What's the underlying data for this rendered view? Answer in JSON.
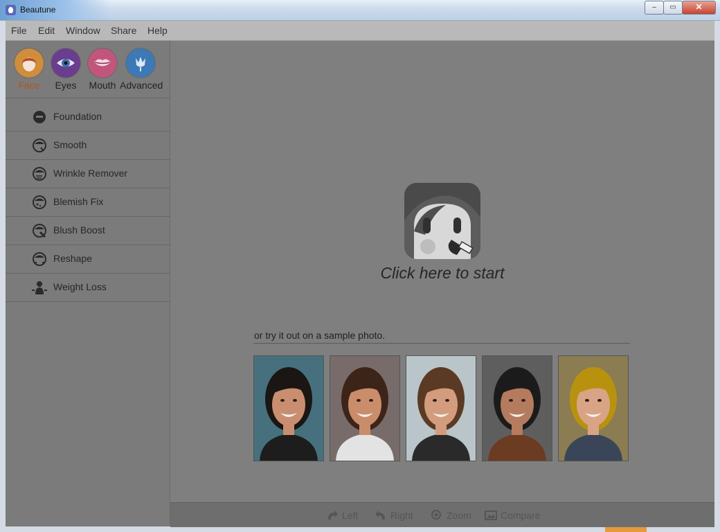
{
  "window": {
    "title": "Beautune",
    "controls": {
      "minimize": "–",
      "maximize": "▭",
      "close": "✕"
    }
  },
  "menu": [
    "File",
    "Edit",
    "Window",
    "Share",
    "Help"
  ],
  "categories": [
    {
      "label": "Face",
      "icon": "face-icon",
      "color": "#d08d3b",
      "active": true
    },
    {
      "label": "Eyes",
      "icon": "eye-icon",
      "color": "#6b3d8e"
    },
    {
      "label": "Mouth",
      "icon": "lips-icon",
      "color": "#c2557b"
    },
    {
      "label": "Advanced",
      "icon": "flower-icon",
      "color": "#3d79b6"
    }
  ],
  "tools": [
    {
      "label": "Foundation",
      "icon": "foundation-icon"
    },
    {
      "label": "Smooth",
      "icon": "smooth-icon"
    },
    {
      "label": "Wrinkle Remover",
      "icon": "wrinkle-icon"
    },
    {
      "label": "Blemish Fix",
      "icon": "blemish-icon"
    },
    {
      "label": "Blush Boost",
      "icon": "blush-icon"
    },
    {
      "label": "Reshape",
      "icon": "reshape-icon"
    },
    {
      "label": "Weight Loss",
      "icon": "weight-loss-icon"
    }
  ],
  "main": {
    "start_text": "Click here to start",
    "sample_text": "or try it out on a sample photo.",
    "sample_photos": [
      {
        "name": "sample-photo-1",
        "bg": "#46707d",
        "hair": "#1b1613",
        "skin": "#c98e70",
        "shirt": "#1d1d1d"
      },
      {
        "name": "sample-photo-2",
        "bg": "#786c6a",
        "hair": "#3d2418",
        "skin": "#c98d6b",
        "shirt": "#e3e3e3"
      },
      {
        "name": "sample-photo-3",
        "bg": "#b9c5c9",
        "hair": "#5a3a24",
        "skin": "#d39c7c",
        "shirt": "#2a2a2a"
      },
      {
        "name": "sample-photo-4",
        "bg": "#5e5e5e",
        "hair": "#1b1b1b",
        "skin": "#b57b5e",
        "shirt": "#6b3b22"
      },
      {
        "name": "sample-photo-5",
        "bg": "#8b7c52",
        "hair": "#b8920f",
        "skin": "#d9a385",
        "shirt": "#3a4658"
      }
    ]
  },
  "bottom_bar": [
    {
      "label": "Left",
      "icon": "rotate-left-icon"
    },
    {
      "label": "Right",
      "icon": "rotate-right-icon"
    },
    {
      "label": "Zoom",
      "icon": "zoom-icon"
    },
    {
      "label": "Compare",
      "icon": "compare-icon"
    }
  ]
}
